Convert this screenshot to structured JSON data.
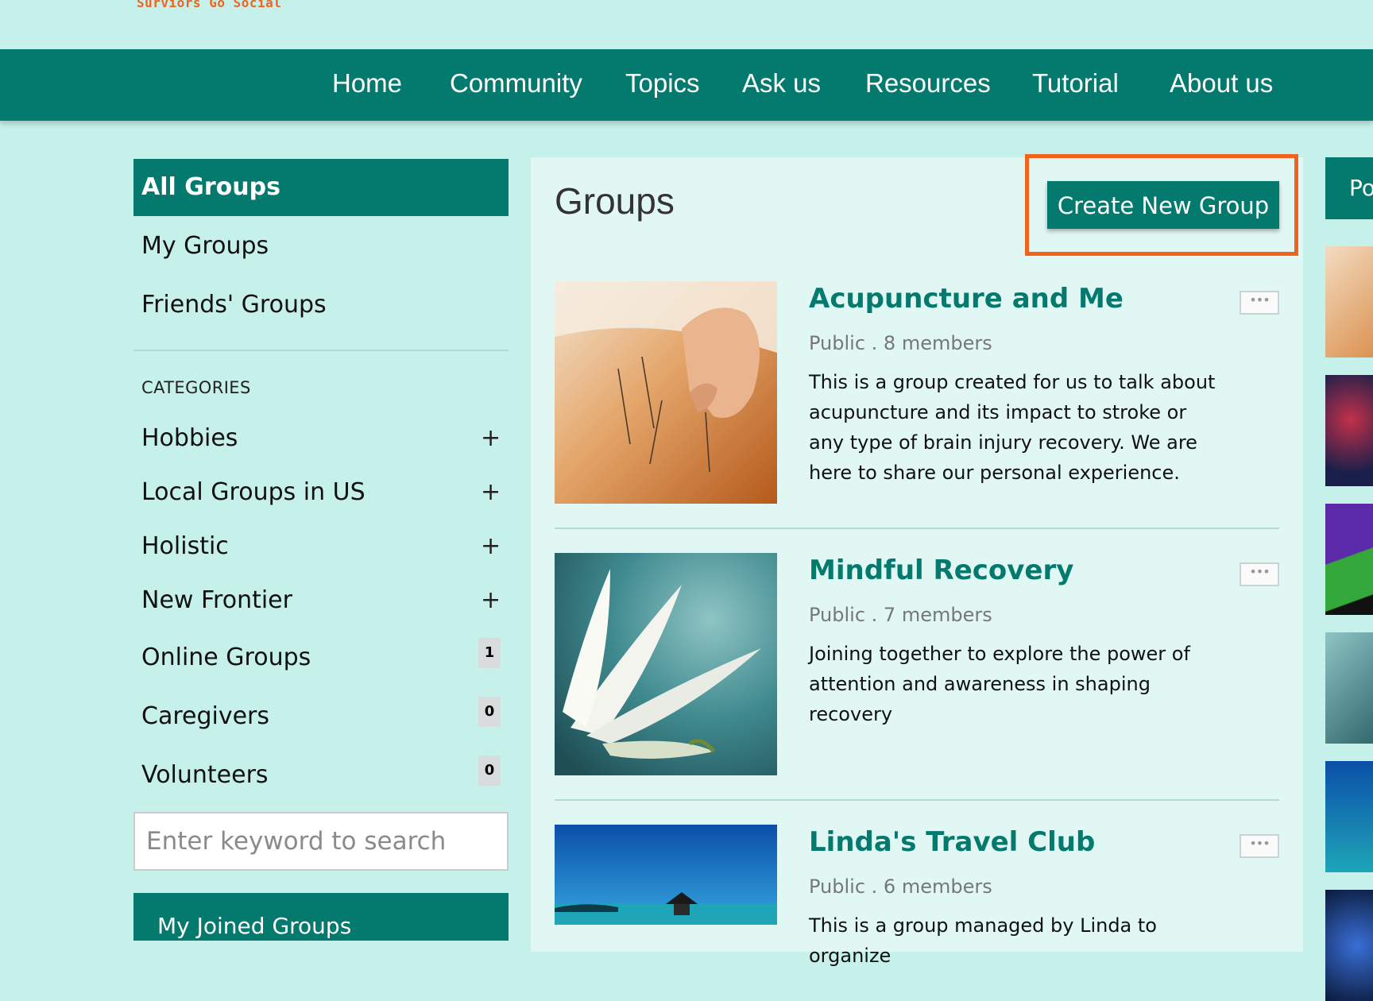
{
  "logo": {
    "text": "Surviors Go Social"
  },
  "nav": {
    "items": [
      "Home",
      "Community",
      "Topics",
      "Ask us",
      "Resources",
      "Tutorial",
      "About us"
    ]
  },
  "sidebar": {
    "active": "All Groups",
    "links": [
      "My Groups",
      "Friends' Groups"
    ],
    "categories_heading": "CATEGORIES",
    "categories": [
      {
        "label": "Hobbies",
        "control": "+"
      },
      {
        "label": "Local Groups in US",
        "control": "+"
      },
      {
        "label": "Holistic",
        "control": "+"
      },
      {
        "label": "New Frontier",
        "control": "+"
      },
      {
        "label": "Online Groups",
        "count": "1"
      },
      {
        "label": "Caregivers",
        "count": "0"
      },
      {
        "label": "Volunteers",
        "count": "0"
      }
    ],
    "search_placeholder": "Enter keyword to search",
    "joined_header": "My Joined Groups"
  },
  "main": {
    "title": "Groups",
    "create_button": "Create New Group",
    "more_icon": "ellipsis-icon",
    "groups": [
      {
        "title": "Acupuncture and Me",
        "meta": "Public . 8 members",
        "description": "This is a group created for us to talk about acupuncture and its impact to stroke or any type of brain injury recovery. We are here to share our personal experience.",
        "image": "acupuncture-photo"
      },
      {
        "title": "Mindful Recovery",
        "meta": "Public . 7 members",
        "description": "Joining together to explore the power of attention and awareness in shaping recovery",
        "image": "white-lily-photo"
      },
      {
        "title": "Linda's Travel Club",
        "meta": "Public . 6 members",
        "description": "This is a group managed by Linda to organize",
        "image": "tropical-beach-photo"
      }
    ]
  },
  "right_column": {
    "header": "Po"
  },
  "colors": {
    "brand_teal": "#047a6e",
    "page_bg": "#c6f0ea",
    "panel_bg": "#e0f7f4",
    "highlight_orange": "#f2621d"
  }
}
